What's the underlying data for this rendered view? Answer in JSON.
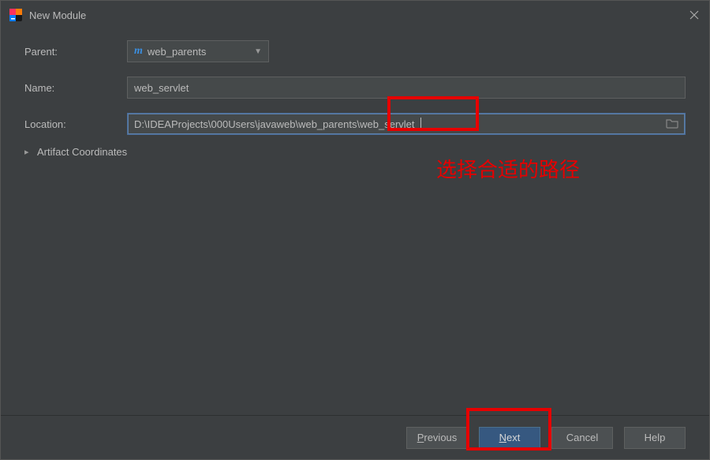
{
  "window": {
    "title": "New Module"
  },
  "form": {
    "parent_label": "Parent:",
    "parent_value": "web_parents",
    "name_label": "Name:",
    "name_value": "web_servlet",
    "location_label": "Location:",
    "location_value": "D:\\IDEAProjects\\000Users\\javaweb\\web_parents\\web_servlet",
    "artifact_label": "Artifact Coordinates"
  },
  "buttons": {
    "previous": "Previous",
    "next": "Next",
    "cancel": "Cancel",
    "help": "Help"
  },
  "annotation": {
    "text": "选择合适的路径"
  }
}
